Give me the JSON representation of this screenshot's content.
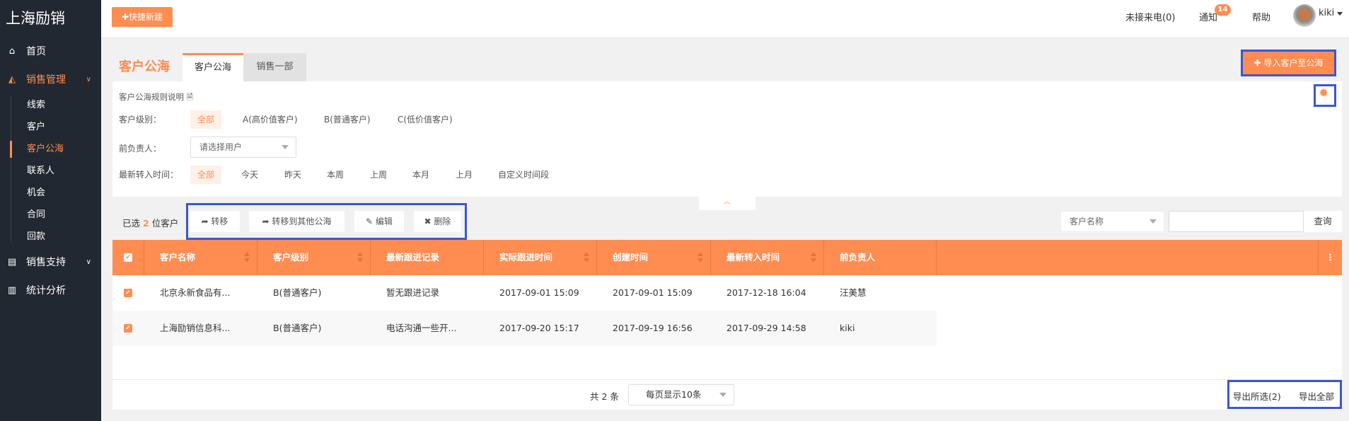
{
  "sidebar": {
    "logo": "上海励销",
    "items": [
      {
        "label": "首页",
        "icon": "home-icon"
      },
      {
        "label": "销售管理",
        "icon": "area-chart-icon",
        "sub": [
          "线索",
          "客户",
          "客户公海",
          "联系人",
          "机会",
          "合同",
          "回款"
        ]
      },
      {
        "label": "销售支持",
        "icon": "file-icon"
      },
      {
        "label": "统计分析",
        "icon": "bar-chart-icon"
      }
    ],
    "active_sub": "客户公海"
  },
  "topbar": {
    "quick_new": "快捷新建",
    "missed_calls": "未接来电(0)",
    "notify": "通知",
    "notify_count": "14",
    "help": "帮助",
    "user": "kiki"
  },
  "page": {
    "title": "客户公海",
    "tabs": [
      "客户公海",
      "销售一部"
    ],
    "import_btn": "导入客户至公海"
  },
  "filters": {
    "rule_link": "客户公海规则说明",
    "level_label": "客户级别：",
    "levels": [
      "全部",
      "A(高价值客户)",
      "B(普通客户)",
      "C(低价值客户)"
    ],
    "owner_label": "前负责人：",
    "owner_placeholder": "请选择用户",
    "time_label": "最新转入时间：",
    "times": [
      "全部",
      "今天",
      "昨天",
      "本周",
      "上周",
      "本月",
      "上月",
      "自定义时间段"
    ]
  },
  "toolbar": {
    "selected_prefix": "已选",
    "selected_count": "2",
    "selected_suffix": "位客户",
    "transfer": "转移",
    "transfer_other": "转移到其他公海",
    "edit": "编辑",
    "delete": "删除",
    "search_field": "客户名称",
    "search_value": "",
    "query": "查询"
  },
  "colors": {
    "accent": "#ff8c50",
    "sidebar": "#222831"
  },
  "table": {
    "columns": [
      "客户名称",
      "客户级别",
      "最新跟进记录",
      "实际跟进时间",
      "创建时间",
      "最新转入时间",
      "前负责人"
    ],
    "rows": [
      [
        "北京永新食品有...",
        "B(普通客户)",
        "暂无跟进记录",
        "2017-09-01 15:09",
        "2017-09-01 15:09",
        "2017-12-18 16:04",
        "汪美慧"
      ],
      [
        "上海励销信息科...",
        "B(普通客户)",
        "电话沟通一些开...",
        "2017-09-20 15:17",
        "2017-09-19 16:56",
        "2017-09-29 14:58",
        "kiki"
      ]
    ]
  },
  "footer": {
    "total": "共 2 条",
    "page_size": "每页显示10条",
    "export_selected": "导出所选(2)",
    "export_all": "导出全部"
  }
}
